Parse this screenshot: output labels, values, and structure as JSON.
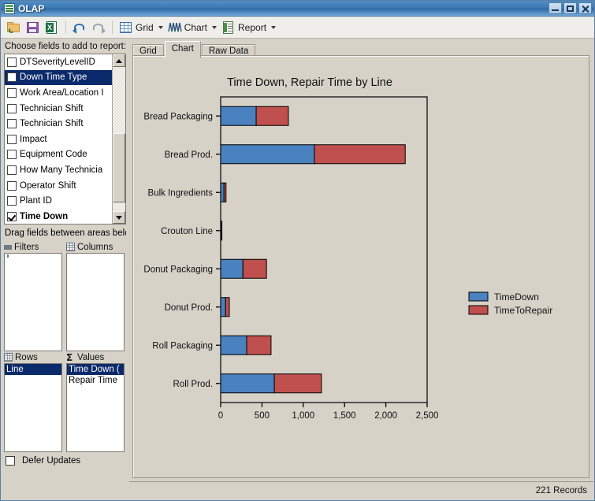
{
  "window": {
    "title": "OLAP",
    "icon": "grid-app-icon",
    "minimize_label": "Minimize",
    "maximize_label": "Maximize",
    "close_label": "Close"
  },
  "toolbar": {
    "open_label": "",
    "save_label": "",
    "excel_label": "X",
    "undo_label": "",
    "redo_label": "",
    "grid_label": "Grid",
    "chart_label": "Chart",
    "report_label": "Report"
  },
  "field_panel": {
    "heading": "Choose fields to add to report:",
    "fields": [
      {
        "label": "DTSeverityLevelID",
        "checked": false,
        "selected": false,
        "bold": false
      },
      {
        "label": "Down Time Type",
        "checked": false,
        "selected": true,
        "bold": false
      },
      {
        "label": "Work Area/Location I",
        "checked": false,
        "selected": false,
        "bold": false
      },
      {
        "label": "Technician Shift",
        "checked": false,
        "selected": false,
        "bold": false
      },
      {
        "label": "Technician Shift",
        "checked": false,
        "selected": false,
        "bold": false
      },
      {
        "label": "Impact",
        "checked": false,
        "selected": false,
        "bold": false
      },
      {
        "label": "Equipment Code",
        "checked": false,
        "selected": false,
        "bold": false
      },
      {
        "label": "How Many Technicia",
        "checked": false,
        "selected": false,
        "bold": false
      },
      {
        "label": "Operator Shift",
        "checked": false,
        "selected": false,
        "bold": false
      },
      {
        "label": "Plant ID",
        "checked": false,
        "selected": false,
        "bold": false
      },
      {
        "label": "Time Down",
        "checked": true,
        "selected": false,
        "bold": true
      }
    ],
    "drag_note": "Drag fields between areas belo",
    "zones": [
      {
        "name": "Filters",
        "icon": "funnel-icon",
        "items": []
      },
      {
        "name": "Columns",
        "icon": "table-icon",
        "items": []
      },
      {
        "name": "Rows",
        "icon": "table-icon",
        "items": [
          {
            "label": "Line",
            "selected": true
          }
        ]
      },
      {
        "name": "Values",
        "icon": "sigma-icon",
        "items": [
          {
            "label": "Time Down (",
            "selected": true
          },
          {
            "label": "Repair Time",
            "selected": false
          }
        ]
      }
    ],
    "defer_updates_label": "Defer Updates",
    "defer_updates_checked": false
  },
  "tabs": [
    {
      "label": "Grid",
      "active": false
    },
    {
      "label": "Chart",
      "active": true
    },
    {
      "label": "Raw Data",
      "active": false
    }
  ],
  "status": {
    "records_text": "221 Records"
  },
  "colors": {
    "series_time_down": "#4a81bf",
    "series_time_to_repair": "#c0504d",
    "plot_background": "#d6d2c8",
    "selection_blue": "#0b2a6b",
    "titlebar_blue": "#3d79b4"
  },
  "chart_data": {
    "type": "bar",
    "orientation": "horizontal",
    "stacked": true,
    "title": "Time Down, Repair Time by Line",
    "xlabel": "",
    "ylabel": "",
    "xlim": [
      0,
      2500
    ],
    "xticks": [
      0,
      500,
      1000,
      1500,
      2000,
      2500
    ],
    "xtick_labels": [
      "0",
      "500",
      "1,000",
      "1,500",
      "2,000",
      "2,500"
    ],
    "grid": false,
    "legend_position": "right",
    "categories": [
      "Bread Packaging",
      "Bread Prod.",
      "Bulk Ingredients",
      "Crouton Line",
      "Donut Packaging",
      "Donut Prod.",
      "Roll Packaging",
      "Roll Prod."
    ],
    "series": [
      {
        "name": "TimeDown",
        "color": "#4a81bf",
        "values": [
          430,
          1135,
          40,
          5,
          270,
          60,
          315,
          650
        ]
      },
      {
        "name": "TimeToRepair",
        "color": "#c0504d",
        "values": [
          390,
          1100,
          25,
          10,
          285,
          45,
          295,
          570
        ]
      }
    ]
  }
}
